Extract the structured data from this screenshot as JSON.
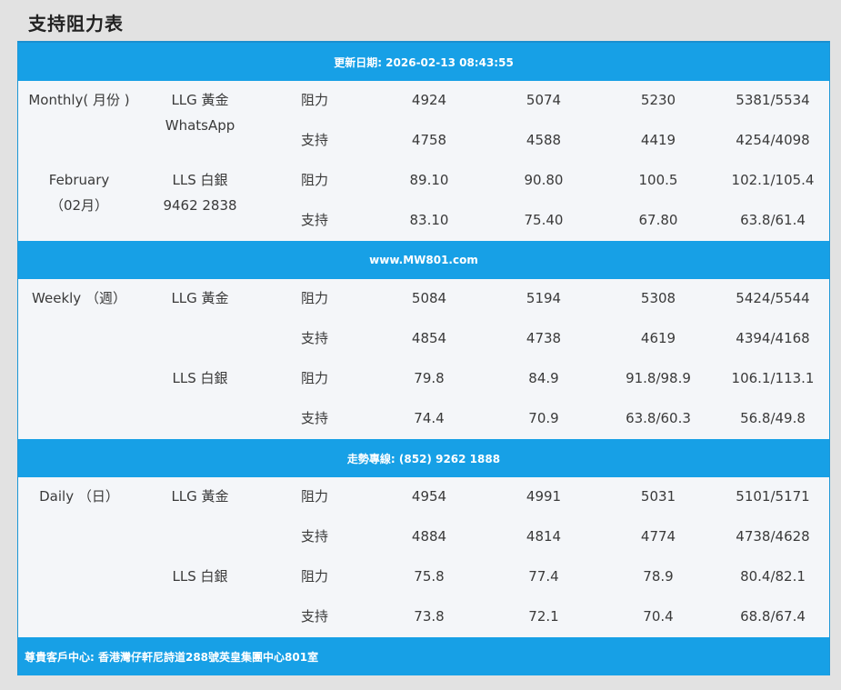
{
  "page_title": "支持阻力表",
  "banners": {
    "updated": "更新日期: 2026-02-13 08:43:55",
    "website": "www.MW801.com",
    "hotline": "走勢專線: (852) 9262 1888",
    "address": "尊貴客戶中心: 香港灣仔軒尼詩道288號英皇集團中心801室"
  },
  "monthly": {
    "period_line1": "Monthly( 月份 )",
    "period_line2": "February",
    "period_line3": "（02月）",
    "gold_label": "LLG 黃金",
    "gold_sub": "WhatsApp",
    "silver_label": "LLS 白銀",
    "silver_sub": "9462 2838",
    "rows": [
      {
        "type": "阻力",
        "v1": "4924",
        "v2": "5074",
        "v3": "5230",
        "v4": "5381/5534"
      },
      {
        "type": "支持",
        "v1": "4758",
        "v2": "4588",
        "v3": "4419",
        "v4": "4254/4098"
      },
      {
        "type": "阻力",
        "v1": "89.10",
        "v2": "90.80",
        "v3": "100.5",
        "v4": "102.1/105.4"
      },
      {
        "type": "支持",
        "v1": "83.10",
        "v2": "75.40",
        "v3": "67.80",
        "v4": "63.8/61.4"
      }
    ]
  },
  "weekly": {
    "period_line1": "Weekly （週）",
    "gold_label": "LLG 黃金",
    "silver_label": "LLS 白銀",
    "rows": [
      {
        "type": "阻力",
        "v1": "5084",
        "v2": "5194",
        "v3": "5308",
        "v4": "5424/5544"
      },
      {
        "type": "支持",
        "v1": "4854",
        "v2": "4738",
        "v3": "4619",
        "v4": "4394/4168"
      },
      {
        "type": "阻力",
        "v1": "79.8",
        "v2": "84.9",
        "v3": "91.8/98.9",
        "v4": "106.1/113.1"
      },
      {
        "type": "支持",
        "v1": "74.4",
        "v2": "70.9",
        "v3": "63.8/60.3",
        "v4": "56.8/49.8"
      }
    ]
  },
  "daily": {
    "period_line1": "Daily （日）",
    "gold_label": "LLG 黃金",
    "silver_label": "LLS 白銀",
    "rows": [
      {
        "type": "阻力",
        "v1": "4954",
        "v2": "4991",
        "v3": "5031",
        "v4": "5101/5171"
      },
      {
        "type": "支持",
        "v1": "4884",
        "v2": "4814",
        "v3": "4774",
        "v4": "4738/4628"
      },
      {
        "type": "阻力",
        "v1": "75.8",
        "v2": "77.4",
        "v3": "78.9",
        "v4": "80.4/82.1"
      },
      {
        "type": "支持",
        "v1": "73.8",
        "v2": "72.1",
        "v3": "70.4",
        "v4": "68.8/67.4"
      }
    ]
  },
  "colors": {
    "banner": "#17a0e6",
    "panel": "#f4f6f9",
    "page": "#e2e2e2"
  }
}
